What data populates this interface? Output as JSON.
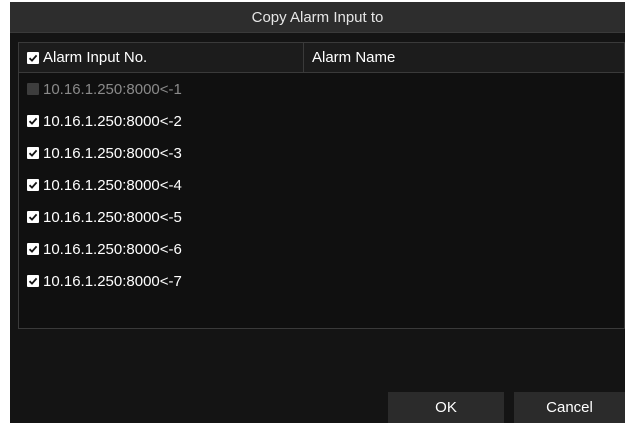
{
  "dialog": {
    "title": "Copy Alarm Input to",
    "columns": {
      "input_no": "Alarm Input No.",
      "name": "Alarm Name"
    },
    "select_all_checked": true,
    "rows": [
      {
        "label": "10.16.1.250:8000<-1",
        "checked": false,
        "disabled": true
      },
      {
        "label": "10.16.1.250:8000<-2",
        "checked": true,
        "disabled": false
      },
      {
        "label": "10.16.1.250:8000<-3",
        "checked": true,
        "disabled": false
      },
      {
        "label": "10.16.1.250:8000<-4",
        "checked": true,
        "disabled": false
      },
      {
        "label": "10.16.1.250:8000<-5",
        "checked": true,
        "disabled": false
      },
      {
        "label": "10.16.1.250:8000<-6",
        "checked": true,
        "disabled": false
      },
      {
        "label": "10.16.1.250:8000<-7",
        "checked": true,
        "disabled": false
      }
    ],
    "buttons": {
      "ok": "OK",
      "cancel": "Cancel"
    }
  }
}
